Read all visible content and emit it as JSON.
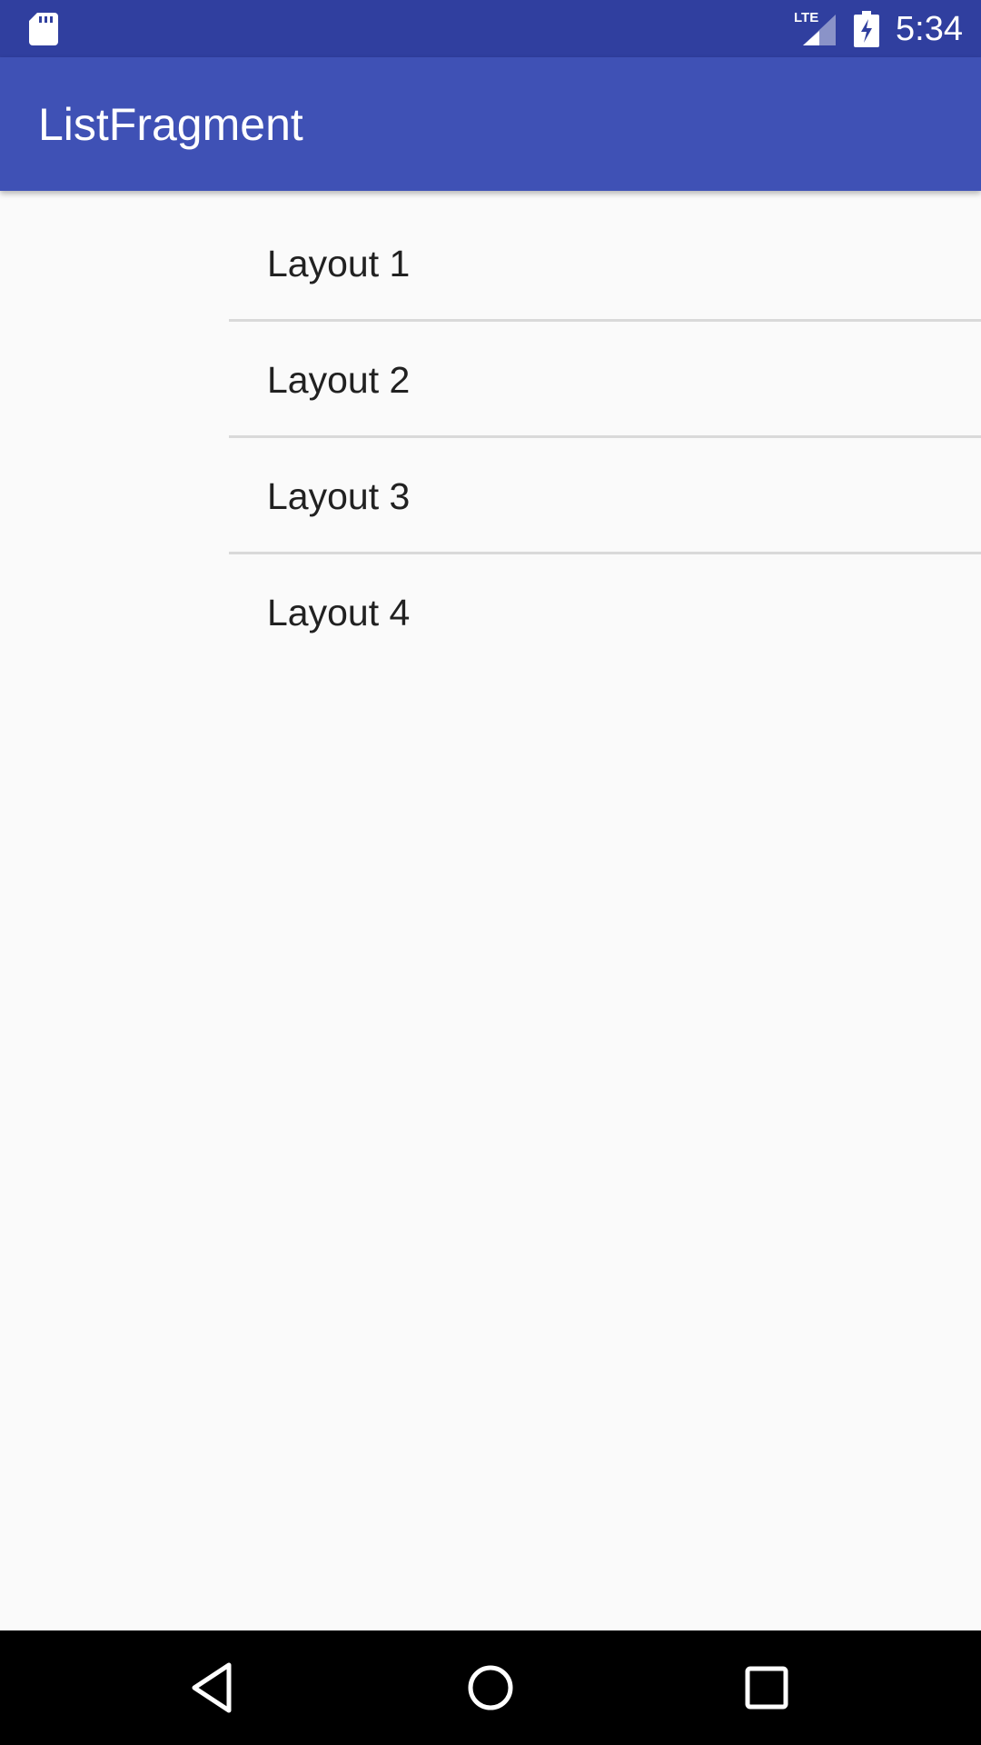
{
  "status_bar": {
    "time": "5:34",
    "network_label": "LTE",
    "icons": [
      "sd-card-icon",
      "lte-signal-icon",
      "battery-charging-icon"
    ]
  },
  "app_bar": {
    "title": "ListFragment",
    "color": "#3f51b5",
    "status_color": "#303f9f"
  },
  "list": {
    "items": [
      {
        "label": "Layout 1"
      },
      {
        "label": "Layout 2"
      },
      {
        "label": "Layout 3"
      },
      {
        "label": "Layout 4"
      }
    ]
  },
  "nav_bar": {
    "icons": [
      "back-icon",
      "home-icon",
      "recents-icon"
    ]
  }
}
